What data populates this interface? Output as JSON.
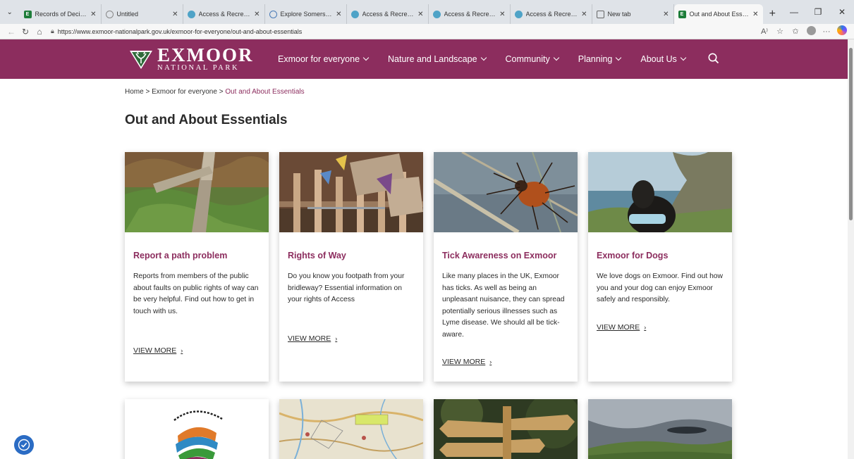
{
  "browser": {
    "tabs": [
      {
        "title": "Records of Decisions an",
        "fav": "#1e7d3a",
        "fav_letter": "E"
      },
      {
        "title": "Untitled",
        "fav": "#888888",
        "fav_letter": ""
      },
      {
        "title": "Access & Recreation - E",
        "fav": "#4fa3c7",
        "fav_letter": ""
      },
      {
        "title": "Explore Somerset -",
        "fav": "#4a7bb7",
        "fav_letter": ""
      },
      {
        "title": "Access & Recreation - A",
        "fav": "#4fa3c7",
        "fav_letter": ""
      },
      {
        "title": "Access & Recreation - E",
        "fav": "#4fa3c7",
        "fav_letter": ""
      },
      {
        "title": "Access & Recreation - E",
        "fav": "#4fa3c7",
        "fav_letter": ""
      },
      {
        "title": "New tab",
        "fav": "#666666",
        "fav_letter": ""
      },
      {
        "title": "Out and About Essentia",
        "fav": "#1e7d3a",
        "fav_letter": "E"
      }
    ],
    "active_tab_index": 8,
    "url": "https://www.exmoor-nationalpark.gov.uk/exmoor-for-everyone/out-and-about-essentials"
  },
  "site": {
    "logo_main": "EXMOOR",
    "logo_sub": "NATIONAL PARK",
    "brand_color": "#8c2d5e",
    "nav": [
      {
        "label": "Exmoor for everyone"
      },
      {
        "label": "Nature and Landscape"
      },
      {
        "label": "Community"
      },
      {
        "label": "Planning"
      },
      {
        "label": "About Us"
      }
    ]
  },
  "breadcrumb": {
    "home": "Home",
    "sep1": ">",
    "parent": "Exmoor for everyone",
    "sep2": ">",
    "current": "Out and About Essentials"
  },
  "page": {
    "title": "Out and About Essentials"
  },
  "cards": [
    {
      "title": "Report a path problem",
      "description": "Reports from members of the public about faults on public rights of way can be very helpful. Find out how to get in touch with us.",
      "link": "VIEW MORE",
      "arrow": "›"
    },
    {
      "title": "Rights of Way",
      "description": "Do you know you footpath from your bridleway? Essential information on your rights of Access",
      "link": "VIEW MORE",
      "arrow": "›"
    },
    {
      "title": "Tick Awareness on Exmoor",
      "description": "Like many places in the UK, Exmoor has ticks. As well as being an unpleasant nuisance, they can spread potentially serious illnesses such as Lyme disease. We should all be tick-aware.",
      "link": "VIEW MORE",
      "arrow": "›"
    },
    {
      "title": "Exmoor for Dogs",
      "description": "We love dogs on Exmoor. Find out how you and your dog can enjoy Exmoor safely and responsibly.",
      "link": "VIEW MORE",
      "arrow": "›"
    }
  ]
}
